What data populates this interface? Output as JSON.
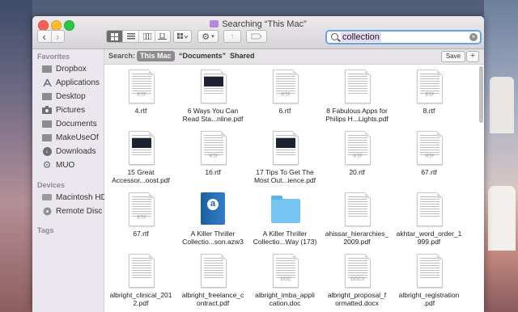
{
  "window": {
    "title": "Searching “This Mac”"
  },
  "toolbar": {
    "back": "‹",
    "forward": "›",
    "action": "⚙",
    "share": "↑"
  },
  "search": {
    "value": "collection",
    "clear": "×"
  },
  "sidebar": {
    "favorites_header": "Favorites",
    "favorites": [
      {
        "label": "Dropbox",
        "icon": "folder-icon"
      },
      {
        "label": "Applications",
        "icon": "applications-icon"
      },
      {
        "label": "Desktop",
        "icon": "folder-icon"
      },
      {
        "label": "Pictures",
        "icon": "camera-icon"
      },
      {
        "label": "Documents",
        "icon": "folder-icon"
      },
      {
        "label": "MakeUseOf",
        "icon": "folder-icon"
      },
      {
        "label": "Downloads",
        "icon": "download-icon"
      },
      {
        "label": "MUO",
        "icon": "gear-icon"
      }
    ],
    "devices_header": "Devices",
    "devices": [
      {
        "label": "Macintosh HD",
        "icon": "disk-icon"
      },
      {
        "label": "Remote Disc",
        "icon": "disc-icon"
      }
    ],
    "tags_header": "Tags"
  },
  "scope": {
    "label": "Search:",
    "options": [
      "This Mac",
      "“Documents”",
      "Shared"
    ],
    "selected": "This Mac",
    "save": "Save",
    "add": "+"
  },
  "files": [
    {
      "line1": "4.rtf",
      "line2": "",
      "kind": "rtf"
    },
    {
      "line1": "6 Ways You Can",
      "line2": "Read Sta...nline.pdf",
      "kind": "pdf-image"
    },
    {
      "line1": "6.rtf",
      "line2": "",
      "kind": "rtf"
    },
    {
      "line1": "8 Fabulous Apps for",
      "line2": "Philips H...Lights.pdf",
      "kind": "pdf"
    },
    {
      "line1": "8.rtf",
      "line2": "",
      "kind": "rtf"
    },
    {
      "line1": "15 Great",
      "line2": "Accessor...oost.pdf",
      "kind": "pdf-image"
    },
    {
      "line1": "16.rtf",
      "line2": "",
      "kind": "rtf"
    },
    {
      "line1": "17 Tips To Get The",
      "line2": "Most Out...ience.pdf",
      "kind": "pdf-image"
    },
    {
      "line1": "20.rtf",
      "line2": "",
      "kind": "rtf"
    },
    {
      "line1": "67.rtf",
      "line2": "",
      "kind": "rtf"
    },
    {
      "line1": "67.rtf",
      "line2": "",
      "kind": "rtf"
    },
    {
      "line1": "A Killer Thriller",
      "line2": "Collectio...son.azw3",
      "kind": "azw3"
    },
    {
      "line1": "A Killer Thriller",
      "line2": "Collectio...Way (173)",
      "kind": "folder"
    },
    {
      "line1": "ahissar_hierarchies_",
      "line2": "2009.pdf",
      "kind": "pdf"
    },
    {
      "line1": "akhtar_word_order_1",
      "line2": "999.pdf",
      "kind": "pdf"
    },
    {
      "line1": "albright_clinical_201",
      "line2": "2.pdf",
      "kind": "pdf"
    },
    {
      "line1": "albright_freelance_c",
      "line2": "ontract.pdf",
      "kind": "pdf"
    },
    {
      "line1": "albright_imba_appli",
      "line2": "cation.doc",
      "kind": "doc"
    },
    {
      "line1": "albright_proposal_f",
      "line2": "ormatted.docx",
      "kind": "docx"
    },
    {
      "line1": "albright_registration",
      "line2": ".pdf",
      "kind": "pdf"
    }
  ],
  "file_ext_labels": {
    "rtf": "RTF",
    "doc": "DOC",
    "docx": "DOCX"
  }
}
